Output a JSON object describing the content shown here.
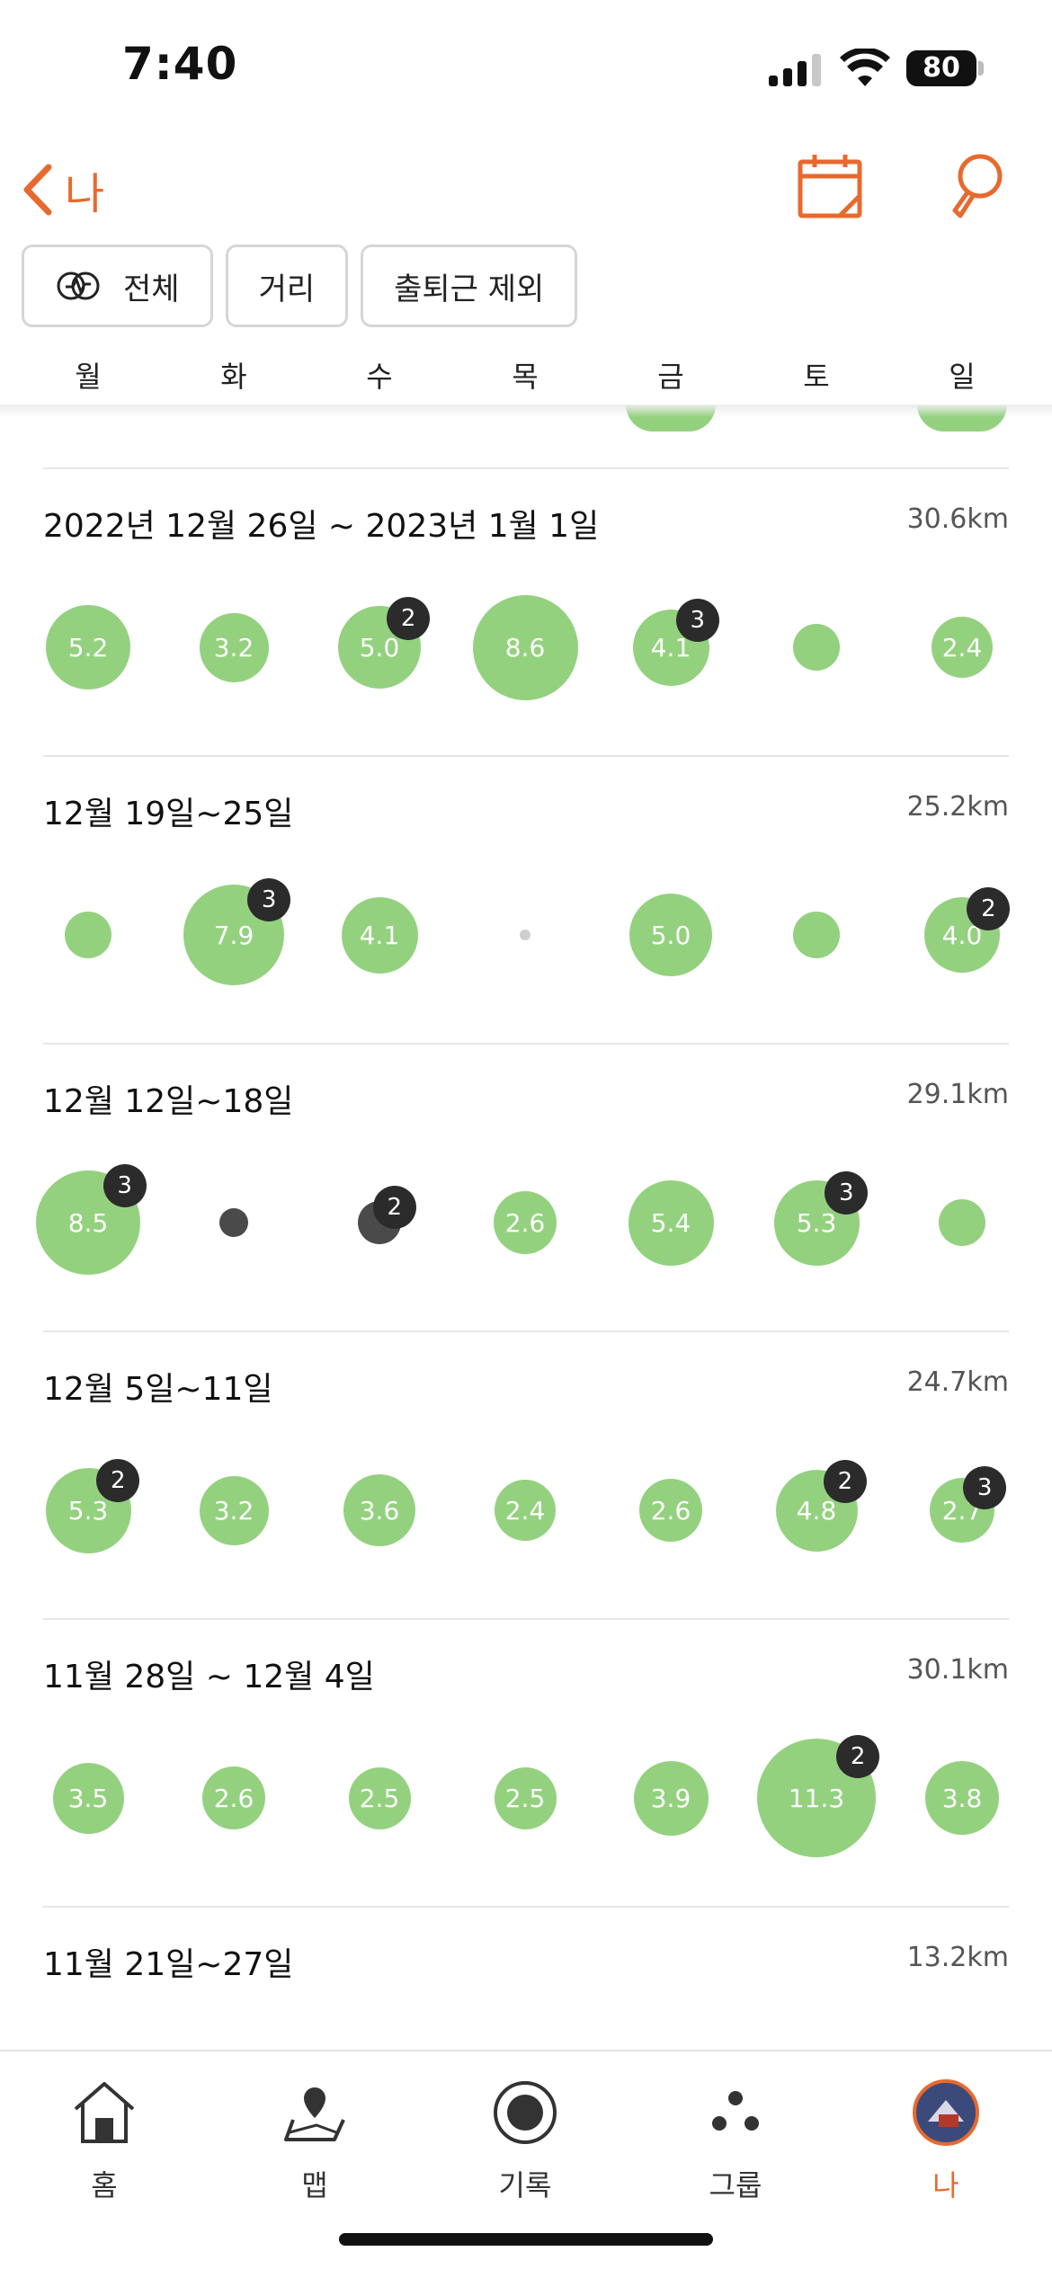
{
  "status_bar": {
    "time": "7:40",
    "battery": "80"
  },
  "header": {
    "back_label": "나"
  },
  "filters": [
    {
      "label": "전체",
      "icon": "activity-icon"
    },
    {
      "label": "거리"
    },
    {
      "label": "출퇴근 제외"
    }
  ],
  "weekdays": [
    "월",
    "화",
    "수",
    "목",
    "금",
    "토",
    "일"
  ],
  "weeks": [
    {
      "title": "2022년 12월 26일 ~ 2023년 1월 1일",
      "total": "30.6km",
      "days": [
        {
          "value": "5.2",
          "badge": null,
          "kind": "normal"
        },
        {
          "value": "3.2",
          "badge": null,
          "kind": "normal"
        },
        {
          "value": "5.0",
          "badge": "2",
          "kind": "normal"
        },
        {
          "value": "8.6",
          "badge": null,
          "kind": "normal"
        },
        {
          "value": "4.1",
          "badge": "3",
          "kind": "normal"
        },
        {
          "value": "",
          "badge": null,
          "kind": "normal"
        },
        {
          "value": "2.4",
          "badge": null,
          "kind": "normal"
        }
      ]
    },
    {
      "title": "12월 19일~25일",
      "total": "25.2km",
      "days": [
        {
          "value": "",
          "badge": null,
          "kind": "normal"
        },
        {
          "value": "7.9",
          "badge": "3",
          "kind": "normal"
        },
        {
          "value": "4.1",
          "badge": null,
          "kind": "normal"
        },
        {
          "value": "",
          "badge": null,
          "kind": "tiny"
        },
        {
          "value": "5.0",
          "badge": null,
          "kind": "normal"
        },
        {
          "value": "",
          "badge": null,
          "kind": "normal"
        },
        {
          "value": "4.0",
          "badge": "2",
          "kind": "normal"
        }
      ]
    },
    {
      "title": "12월 12일~18일",
      "total": "29.1km",
      "days": [
        {
          "value": "8.5",
          "badge": "3",
          "kind": "normal"
        },
        {
          "value": "",
          "badge": null,
          "kind": "dark"
        },
        {
          "value": "",
          "badge": "2",
          "kind": "dark"
        },
        {
          "value": "2.6",
          "badge": null,
          "kind": "normal"
        },
        {
          "value": "5.4",
          "badge": null,
          "kind": "normal"
        },
        {
          "value": "5.3",
          "badge": "3",
          "kind": "normal"
        },
        {
          "value": "",
          "badge": null,
          "kind": "normal"
        }
      ]
    },
    {
      "title": "12월 5일~11일",
      "total": "24.7km",
      "days": [
        {
          "value": "5.3",
          "badge": "2",
          "kind": "normal"
        },
        {
          "value": "3.2",
          "badge": null,
          "kind": "normal"
        },
        {
          "value": "3.6",
          "badge": null,
          "kind": "normal"
        },
        {
          "value": "2.4",
          "badge": null,
          "kind": "normal"
        },
        {
          "value": "2.6",
          "badge": null,
          "kind": "normal"
        },
        {
          "value": "4.8",
          "badge": "2",
          "kind": "normal"
        },
        {
          "value": "2.7",
          "badge": "3",
          "kind": "normal"
        }
      ]
    },
    {
      "title": "11월 28일 ~ 12월 4일",
      "total": "30.1km",
      "days": [
        {
          "value": "3.5",
          "badge": null,
          "kind": "normal"
        },
        {
          "value": "2.6",
          "badge": null,
          "kind": "normal"
        },
        {
          "value": "2.5",
          "badge": null,
          "kind": "normal"
        },
        {
          "value": "2.5",
          "badge": null,
          "kind": "normal"
        },
        {
          "value": "3.9",
          "badge": null,
          "kind": "normal"
        },
        {
          "value": "11.3",
          "badge": "2",
          "kind": "normal"
        },
        {
          "value": "3.8",
          "badge": null,
          "kind": "normal"
        }
      ]
    },
    {
      "title": "11월 21일~27일",
      "total": "13.2km",
      "days": []
    }
  ],
  "tabbar": [
    {
      "label": "홈",
      "icon": "home-icon",
      "active": false
    },
    {
      "label": "맵",
      "icon": "map-icon",
      "active": false
    },
    {
      "label": "기록",
      "icon": "record-icon",
      "active": false
    },
    {
      "label": "그룹",
      "icon": "group-icon",
      "active": false
    },
    {
      "label": "나",
      "icon": "avatar",
      "active": true
    }
  ],
  "colors": {
    "accent": "#e8692e",
    "bubble": "#94d17f",
    "badge": "#2b2b2b"
  }
}
